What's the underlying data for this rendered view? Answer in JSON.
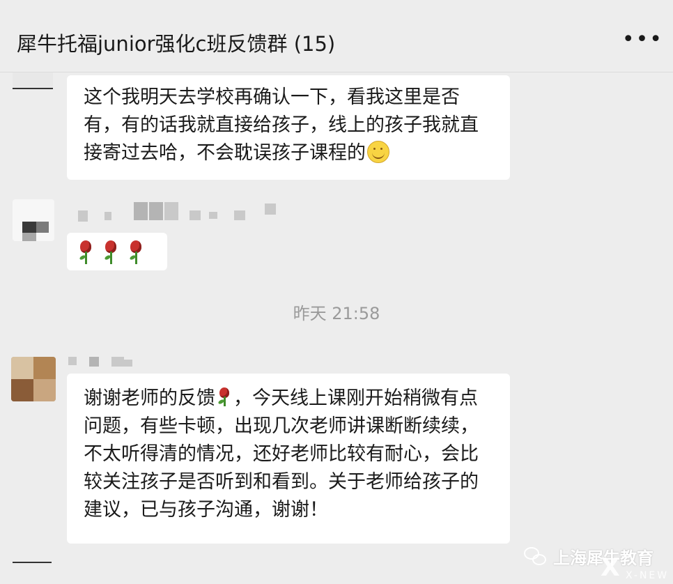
{
  "header": {
    "title": "犀牛托福junior强化c班反馈群 (15)",
    "more_label": "•••"
  },
  "messages": [
    {
      "lines": [
        "这个我明天去学校再确认一下，看我这里是否",
        "有，有的话我就直接给孩子，线上的孩子我就直",
        "接寄过去哈，不会耽误孩子课程的"
      ],
      "emoji": "smile-icon"
    },
    {
      "content": "rose-icon x3",
      "icons": [
        "rose-icon",
        "rose-icon",
        "rose-icon"
      ]
    },
    {
      "lines": [
        "谢谢老师的反馈",
        "，今天线上课刚开始稍微有点",
        "问题，有些卡顿，出现几次老师讲课断断续续，",
        "不太听得清的情况，还好老师比较有耐心，会比",
        "较关注孩子是否听到和看到。关于老师给孩子的",
        "建议，已与孩子沟通，谢谢！"
      ]
    }
  ],
  "timestamp": "昨天 21:58",
  "watermark": {
    "text": "上海犀牛教育",
    "logo_text": "X",
    "logo_sub": "X-NEW"
  },
  "colors": {
    "background": "#ededed",
    "bubble": "#ffffff",
    "timestamp": "#9a9a9a"
  }
}
